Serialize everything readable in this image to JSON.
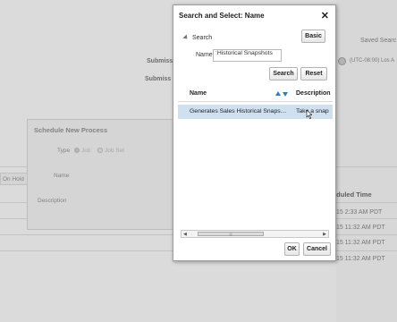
{
  "background": {
    "saved_search": "Saved Searc",
    "submission_label_1": "Submiss",
    "submission_label_2": "Submiss",
    "timezone": "(UTC-08:00) Los A",
    "on_hold": "On Hold",
    "scheduled_time_header": "eduled Time",
    "times": [
      "/15 2:33 AM PDT",
      "/15 11:32 AM PDT",
      "/15 11:32 AM PDT",
      "/15 11:32 AM PDT"
    ]
  },
  "schedule_dialog": {
    "title": "Schedule New Process",
    "type_label": "Type",
    "type_options": [
      "Job",
      "Job Set"
    ],
    "name_label": "Name",
    "description_label": "Description"
  },
  "search_dialog": {
    "title": "Search and Select: Name",
    "close_glyph": "✕",
    "search_section_label": "Search",
    "basic_button": "Basic",
    "name_label": "Name",
    "name_value": ":Historical Snapshots",
    "search_button": "Search",
    "reset_button": "Reset",
    "columns": [
      "Name",
      "Description"
    ],
    "rows": [
      {
        "name": "Generates Sales Historical Snaps…",
        "description": "Take a snap"
      }
    ],
    "scroll_thumb_glyph": "|||",
    "ok_button": "OK",
    "cancel_button": "Cancel"
  },
  "colors": {
    "selected_row": "#cfe0f0",
    "sort_arrow": "#2c7fc4"
  }
}
